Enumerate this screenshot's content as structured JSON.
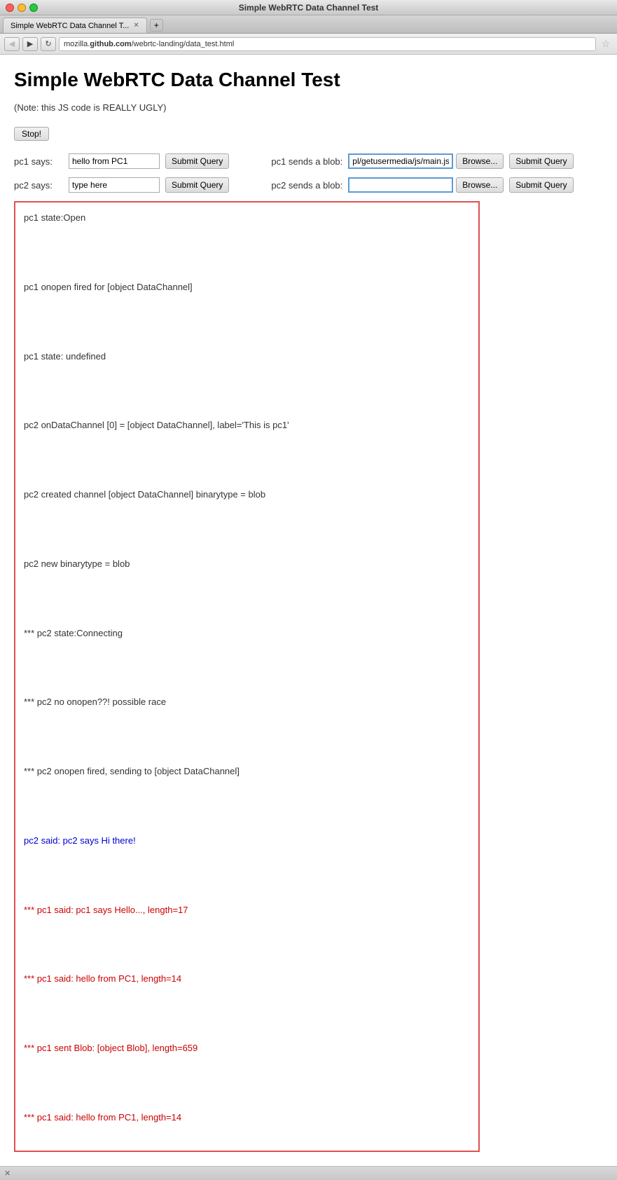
{
  "window": {
    "title": "Simple WebRTC Data Channel Test",
    "tab_label": "Simple WebRTC Data Channel T...",
    "url": "mozilla.github.com/webrtc-landing/data_test.html"
  },
  "page": {
    "title": "Simple WebRTC Data Channel Test",
    "note": "(Note: this JS code is REALLY UGLY)",
    "stop_button": "Stop!",
    "pc1_says_label": "pc1 says:",
    "pc1_says_value": "hello from PC1",
    "pc1_submit": "Submit Query",
    "pc2_says_label": "pc2 says:",
    "pc2_says_value": "type here",
    "pc2_submit": "Submit Query",
    "pc1_blob_label": "pc1 sends a blob:",
    "pc1_blob_path": "pl/getusermedia/js/main.js",
    "pc1_browse": "Browse...",
    "pc1_blob_submit": "Submit Query",
    "pc2_blob_label": "pc2 sends a blob:",
    "pc2_blob_path": "",
    "pc2_browse": "Browse...",
    "pc2_blob_submit": "Submit Query"
  },
  "log": {
    "lines": [
      {
        "text": "pc1 state:Open",
        "color": "normal"
      },
      {
        "text": "",
        "color": "normal"
      },
      {
        "text": "pc1 onopen fired for [object DataChannel]",
        "color": "normal"
      },
      {
        "text": "",
        "color": "normal"
      },
      {
        "text": "pc1 state: undefined",
        "color": "normal"
      },
      {
        "text": "",
        "color": "normal"
      },
      {
        "text": "pc2 onDataChannel [0] = [object DataChannel], label='This is pc1'",
        "color": "normal"
      },
      {
        "text": "",
        "color": "normal"
      },
      {
        "text": "pc2 created channel [object DataChannel] binarytype = blob",
        "color": "normal"
      },
      {
        "text": "",
        "color": "normal"
      },
      {
        "text": "pc2 new binarytype = blob",
        "color": "normal"
      },
      {
        "text": "",
        "color": "normal"
      },
      {
        "text": "*** pc2 state:Connecting",
        "color": "normal"
      },
      {
        "text": "",
        "color": "normal"
      },
      {
        "text": "*** pc2 no onopen??! possible race",
        "color": "normal"
      },
      {
        "text": "",
        "color": "normal"
      },
      {
        "text": "*** pc2 onopen fired, sending to [object DataChannel]",
        "color": "normal"
      },
      {
        "text": "",
        "color": "normal"
      },
      {
        "text": "pc2 said: pc2 says Hi there!",
        "color": "blue"
      },
      {
        "text": "",
        "color": "normal"
      },
      {
        "text": "*** pc1 said: pc1 says Hello..., length=17",
        "color": "red"
      },
      {
        "text": "",
        "color": "normal"
      },
      {
        "text": "*** pc1 said: hello from PC1, length=14",
        "color": "red"
      },
      {
        "text": "",
        "color": "normal"
      },
      {
        "text": "*** pc1 sent Blob: [object Blob], length=659",
        "color": "red"
      },
      {
        "text": "",
        "color": "normal"
      },
      {
        "text": "*** pc1 said: hello from PC1, length=14",
        "color": "red"
      }
    ]
  },
  "nav": {
    "back": "◀",
    "forward": "▶",
    "refresh": "↻",
    "star": "☆"
  },
  "status": {
    "text": "✕"
  }
}
